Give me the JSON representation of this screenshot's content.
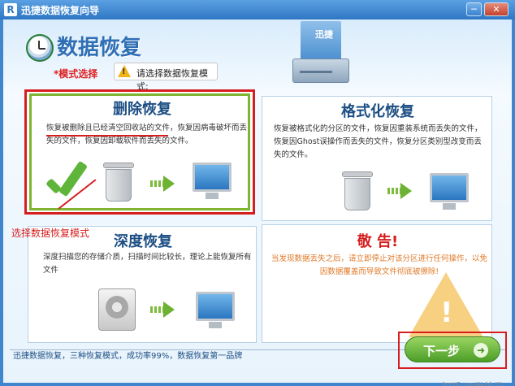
{
  "window": {
    "title": "迅捷数据恢复向导",
    "app_icon_letter": "R",
    "minimize_symbol": "─",
    "close_symbol": "✕"
  },
  "header": {
    "title": "数据恢复",
    "mode_label": "*模式选择",
    "hint": "请选择数据恢复模式:",
    "hint_icon": "warning-icon",
    "drive_label": "迅捷"
  },
  "panels": {
    "delete": {
      "title": "删除恢复",
      "description": "恢复被删除且已经清空回收站的文件，恢复因病毒破坏而丢失的文件，恢复因卸载软件而丢失的文件。"
    },
    "format": {
      "title": "格式化恢复",
      "description": "恢复被格式化的分区的文件，恢复因重装系统而丢失的文件，恢复因Ghost误操作而丢失的文件，恢复分区类别型改变而丢失的文件。"
    },
    "deep": {
      "title": "深度恢复",
      "description": "深度扫描您的存储介质，扫描时间比较长，理论上能恢复所有文件"
    },
    "warning": {
      "title": "敬 告!",
      "description": "当发现数据丢失之后，请立即停止对该分区进行任何操作，以免因数据覆盖而导致文件彻底被擦除!",
      "icon": "warning-triangle-icon"
    }
  },
  "annotation": {
    "text": "选择数据恢复模式"
  },
  "footer": {
    "text": "迅捷数据恢复，三种恢复模式，成功率99%，数据恢复第一品牌",
    "next_button": "下一步",
    "next_icon": "➜"
  },
  "watermark": "知乎 @世外云",
  "colors": {
    "accent_blue": "#2f77c4",
    "highlight_red": "#d61e1e",
    "success_green": "#5fb53a"
  }
}
